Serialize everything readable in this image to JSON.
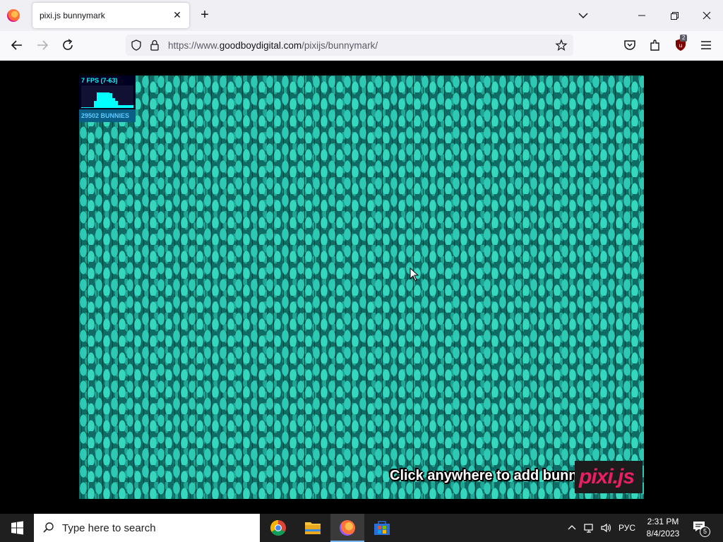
{
  "browser": {
    "tab_title": "pixi.js bunnymark",
    "url_scheme": "https://www.",
    "url_host": "goodboydigital.com",
    "url_path": "/pixijs/bunnymark/",
    "extension_badge": "2"
  },
  "page": {
    "fps_label": "7 FPS (7-63)",
    "bunny_count_label": "29502 BUNNIES",
    "click_message": "Click anywhere to add bunnies!",
    "logo_text": "pixi.js"
  },
  "taskbar": {
    "search_placeholder": "Type here to search",
    "language": "РУС",
    "time": "2:31 PM",
    "date": "8/4/2023",
    "notification_count": "5"
  },
  "colors": {
    "bunny_teal": "#2ec9b4",
    "stats_cyan": "#00ffff",
    "pixi_pink": "#e91e63"
  }
}
